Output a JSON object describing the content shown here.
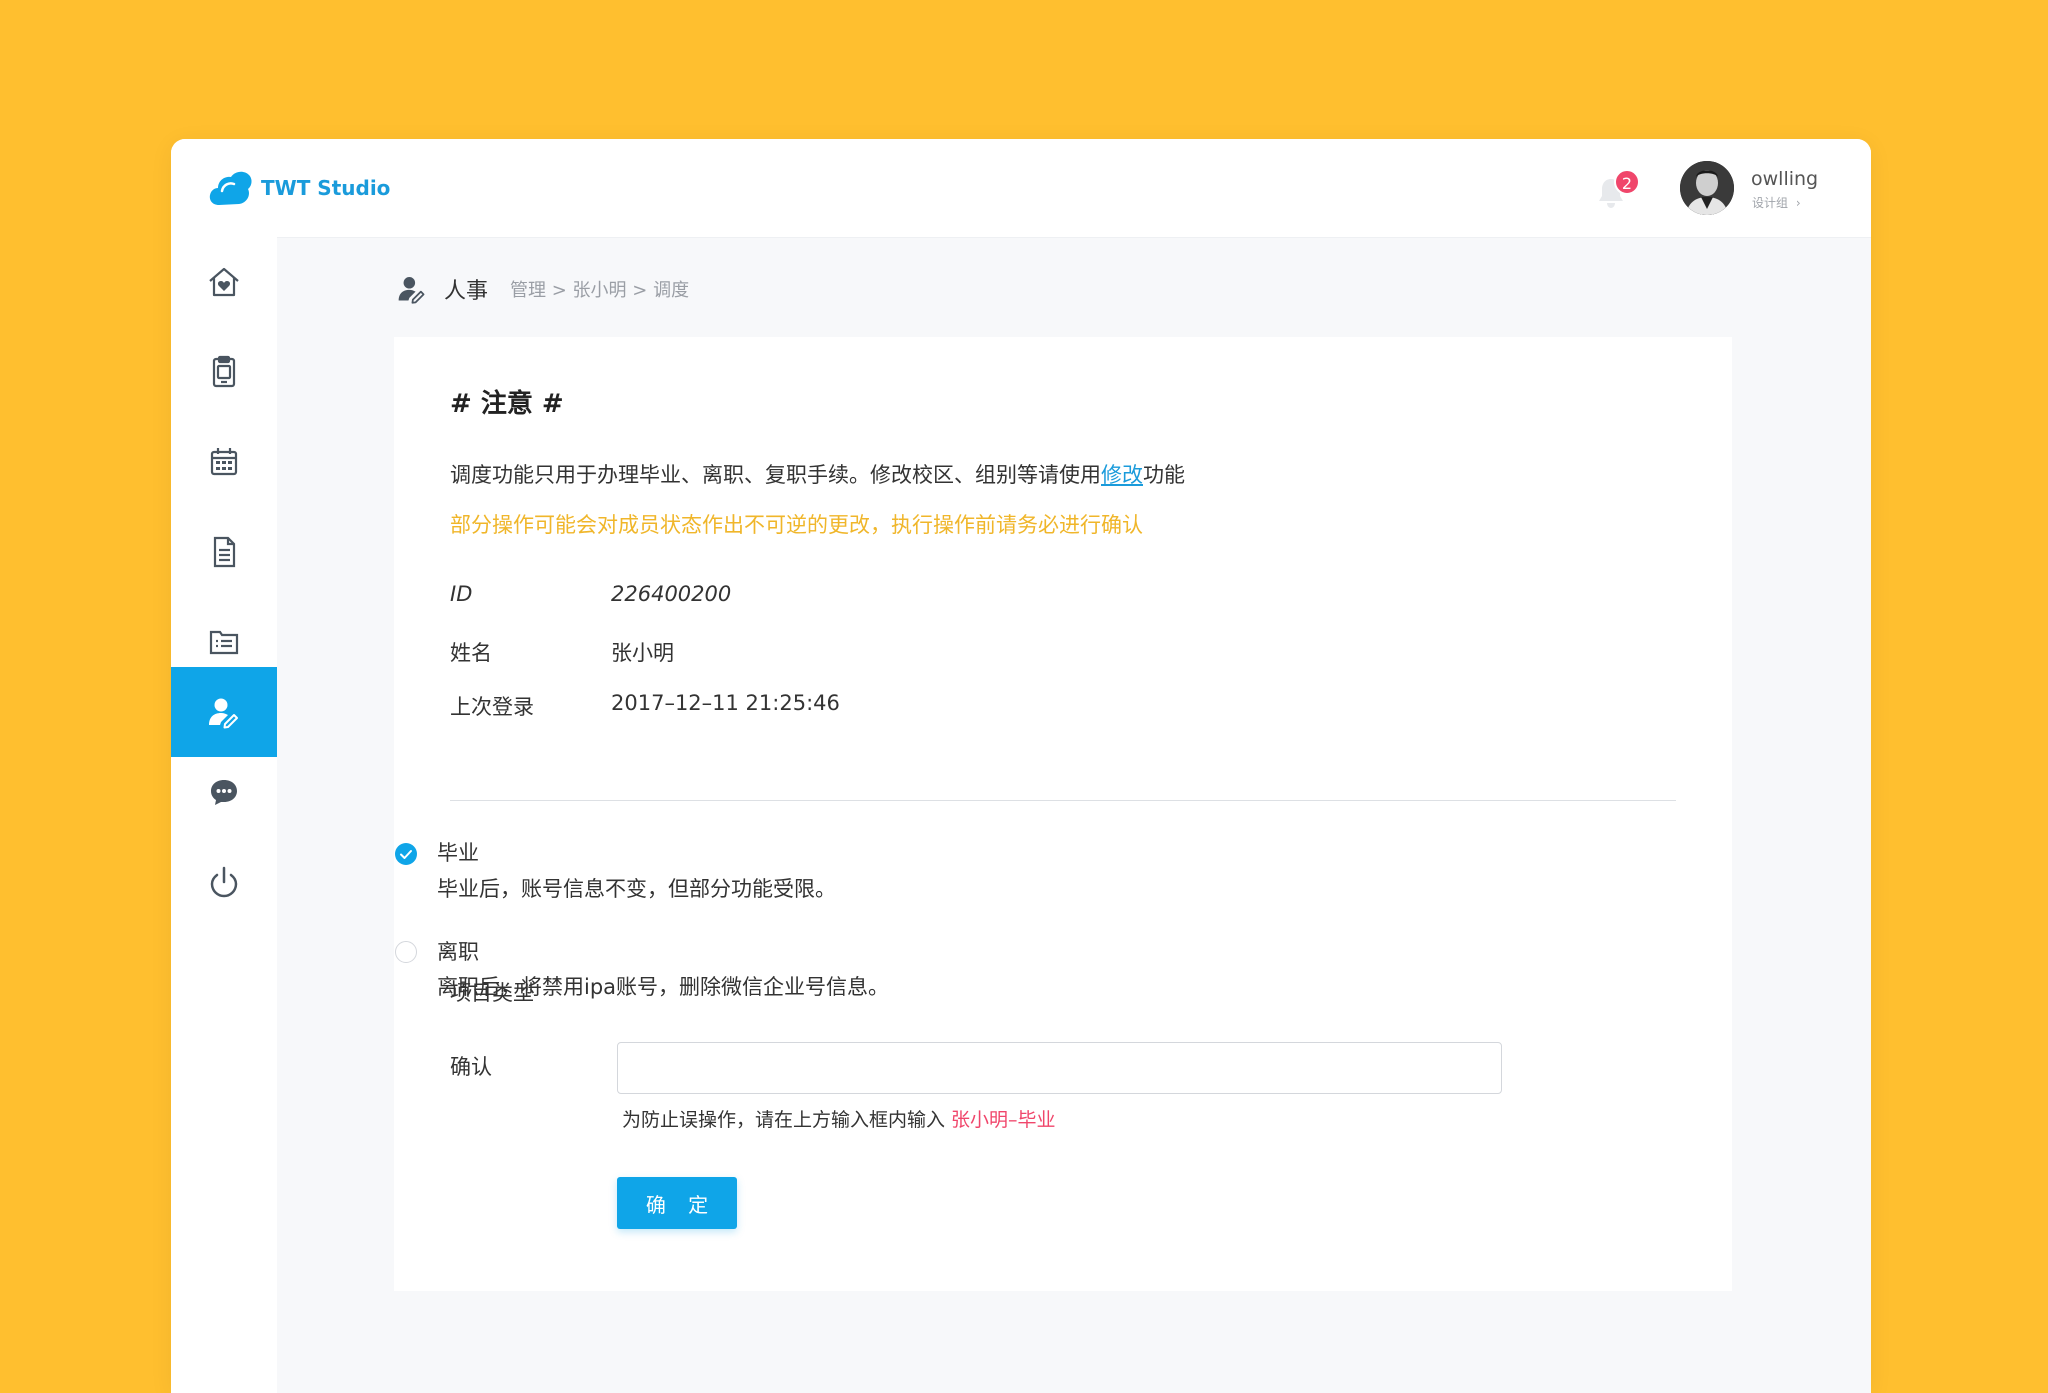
{
  "app": {
    "name": "TWT Studio"
  },
  "header": {
    "notification_count": "2",
    "user": {
      "name": "owlling",
      "group": "设计组",
      "group_chevron": "›"
    }
  },
  "sidebar": {
    "items": [
      {
        "icon": "home-icon"
      },
      {
        "icon": "clipboard-icon"
      },
      {
        "icon": "calendar-icon"
      },
      {
        "icon": "document-icon"
      },
      {
        "icon": "list-folder-icon"
      },
      {
        "icon": "user-edit-icon",
        "active": true
      },
      {
        "icon": "chat-icon"
      },
      {
        "icon": "power-icon"
      }
    ]
  },
  "breadcrumb": {
    "title": "人事",
    "path": "管理 > 张小明 > 调度"
  },
  "notice": {
    "title": "# 注意 #",
    "line_prefix": "调度功能只用于办理毕业、离职、复职手续。修改校区、组别等请使用",
    "line_link": "修改",
    "line_suffix": "功能",
    "warning": "部分操作可能会对成员状态作出不可逆的更改，执行操作前请务必进行确认"
  },
  "info": {
    "id_label": "ID",
    "id_value": "226400200",
    "name_label": "姓名",
    "name_value": "张小明",
    "login_label": "上次登录",
    "login_value": "2017–12–11 21:25:46"
  },
  "project_type": {
    "label": "项目类型",
    "options": [
      {
        "title": "毕业",
        "desc": "毕业后，账号信息不变，但部分功能受限。",
        "selected": true
      },
      {
        "title": "离职",
        "desc": "离职后，将禁用ipa账号，删除微信企业号信息。",
        "selected": false
      }
    ]
  },
  "confirm": {
    "label": "确认",
    "value": "",
    "hint_prefix": "为防止误操作，请在上方输入框内输入 ",
    "hint_key": "张小明–毕业",
    "submit_label": "确 定"
  },
  "colors": {
    "background": "#FFBF2F",
    "accent": "#0FA5E8",
    "warning": "#F0B62A",
    "badge": "#F0466B"
  }
}
